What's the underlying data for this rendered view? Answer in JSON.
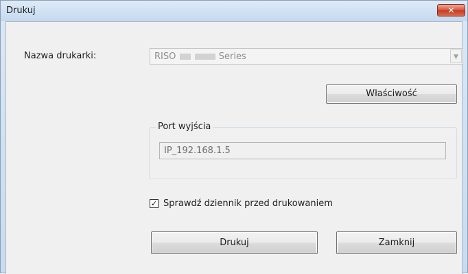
{
  "window": {
    "title": "Drukuj",
    "close_glyph": "✕"
  },
  "printer": {
    "label": "Nazwa drukarki:",
    "selected_prefix": "RISO",
    "selected_suffix": "Series"
  },
  "properties_button": "Właściwość",
  "port_group": {
    "legend": "Port wyjścia",
    "value": "IP_192.168.1.5"
  },
  "check_log": {
    "label": "Sprawdź dziennik przed drukowaniem",
    "checked": true,
    "glyph": "✓"
  },
  "buttons": {
    "print": "Drukuj",
    "close": "Zamknij"
  },
  "icons": {
    "dropdown": "chevron-down-icon",
    "close": "close-icon",
    "check": "check-icon"
  }
}
